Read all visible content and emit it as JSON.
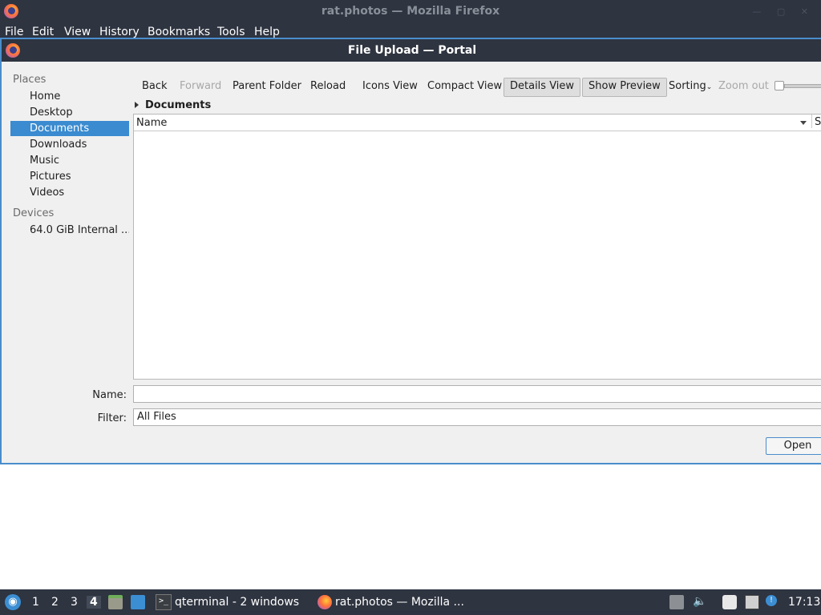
{
  "firefox": {
    "title": "rat.photos — Mozilla Firefox",
    "menu": [
      "File",
      "Edit",
      "View",
      "History",
      "Bookmarks",
      "Tools",
      "Help"
    ]
  },
  "dialog": {
    "title": "File Upload — Portal",
    "sidebar": {
      "places_label": "Places",
      "places": [
        "Home",
        "Desktop",
        "Documents",
        "Downloads",
        "Music",
        "Pictures",
        "Videos"
      ],
      "selected": "Documents",
      "devices_label": "Devices",
      "devices": [
        "64.0 GiB Internal ..."
      ]
    },
    "toolbar": {
      "back": "Back",
      "forward": "Forward",
      "parent_folder": "Parent Folder",
      "reload": "Reload",
      "icons_view": "Icons View",
      "compact_view": "Compact View",
      "details_view": "Details View",
      "show_preview": "Show Preview",
      "sorting": "Sorting",
      "zoom_out": "Zoom out"
    },
    "breadcrumb": "Documents",
    "file_list": {
      "columns": [
        "Name",
        "Si"
      ],
      "rows": []
    },
    "name_label": "Name:",
    "name_value": "",
    "filter_label": "Filter:",
    "filter_value": "All Files",
    "open_button": "Open"
  },
  "taskbar": {
    "workspaces": [
      "1",
      "2",
      "3",
      "4"
    ],
    "active_workspace": "4",
    "tasks": [
      "qterminal - 2 windows",
      "rat.photos — Mozilla ..."
    ],
    "clock": "17:13"
  }
}
